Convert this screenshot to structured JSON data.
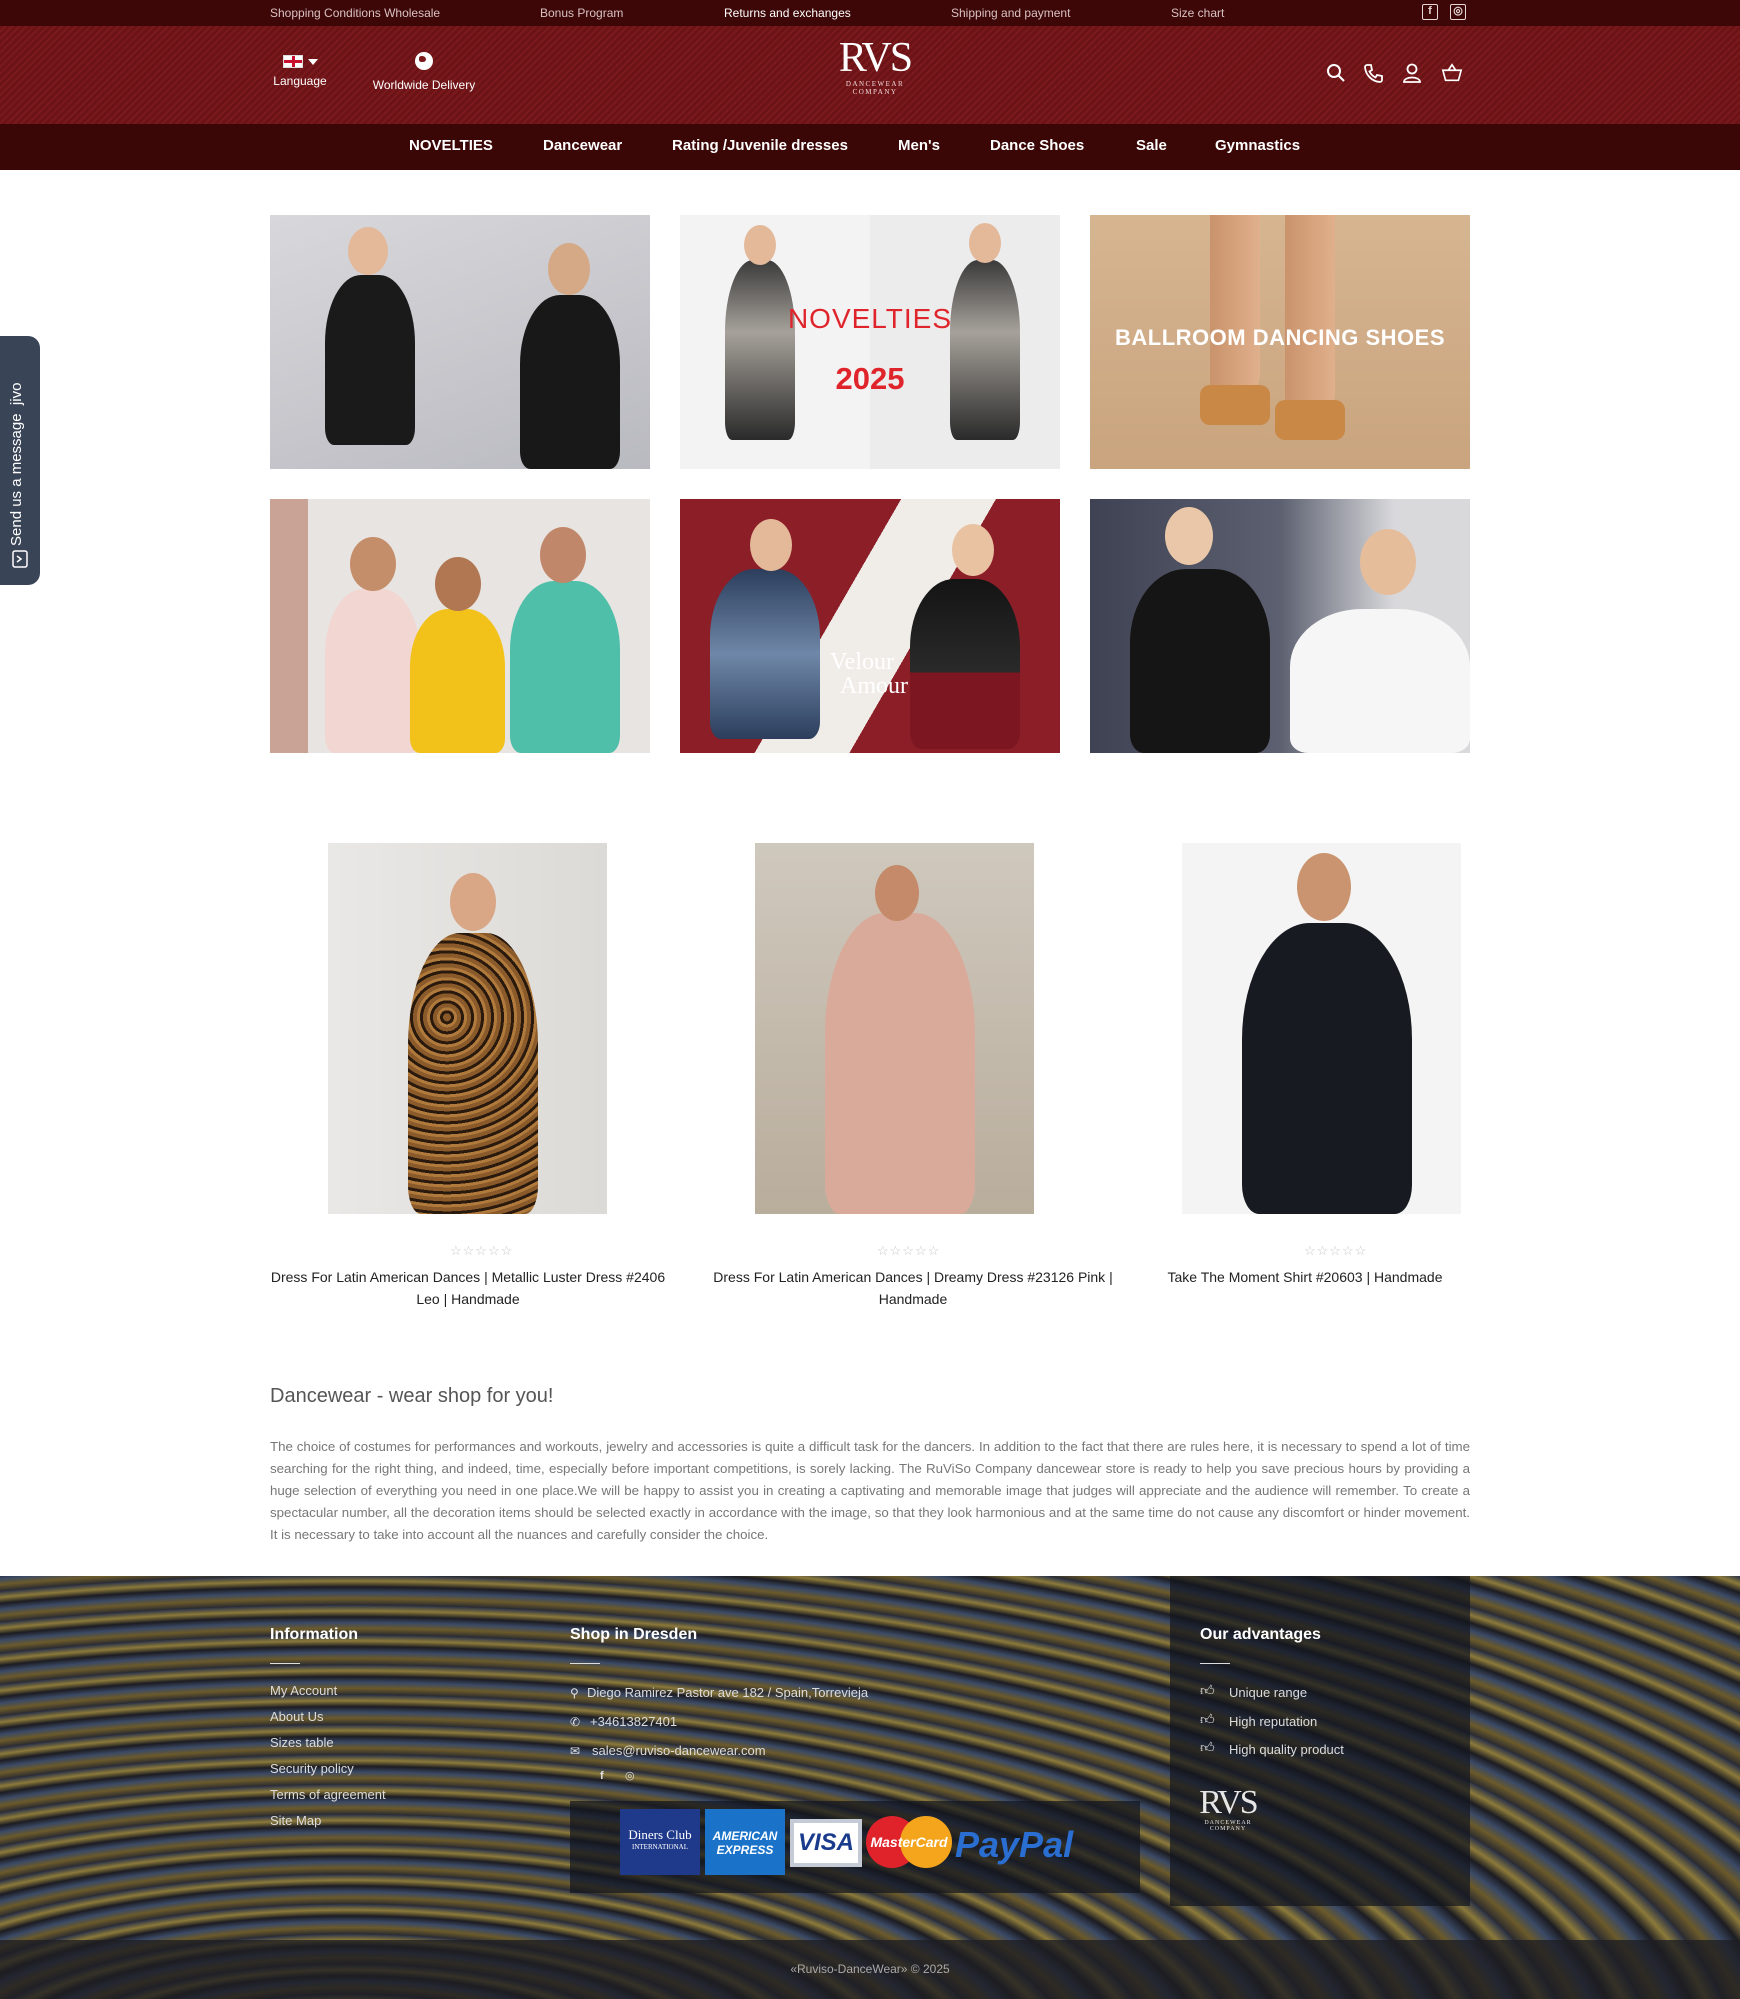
{
  "topbar": {
    "links": [
      "Shopping Conditions Wholesale",
      "Bonus Program",
      "Returns and exchanges",
      "Shipping and payment",
      "Size chart"
    ],
    "social": [
      "facebook-icon",
      "instagram-icon"
    ]
  },
  "header": {
    "language_label": "Language",
    "delivery_label": "Worldwide Delivery",
    "logo_text": "RVS",
    "logo_sub_1": "DANCEWEAR",
    "logo_sub_2": "COMPANY",
    "icons": [
      "search-icon",
      "phone-icon",
      "user-icon",
      "cart-icon"
    ]
  },
  "nav": {
    "items": [
      "NOVELTIES",
      "Dancewear",
      "Rating /Juvenile dresses",
      "Men's",
      "Dance Shoes",
      "Sale",
      "Gymnastics"
    ]
  },
  "tiles": {
    "novelties_word": "NOVELTIES",
    "novelties_year": "2025",
    "shoes_text": "BALLROOM DANCING SHOES",
    "velour_1": "Velour",
    "velour_2": "Amour"
  },
  "products": [
    {
      "title": "Dress For Latin American Dances | Metallic Luster Dress #2406 Leo | Handmade",
      "rating": "☆☆☆☆☆"
    },
    {
      "title": "Dress For Latin American Dances | Dreamy Dress #23126 Pink | Handmade",
      "rating": "☆☆☆☆☆"
    },
    {
      "title": "Take The Moment Shirt #20603 | Handmade",
      "rating": "☆☆☆☆☆"
    }
  ],
  "article": {
    "title": "Dancewear - wear shop for you!",
    "body": "The choice of costumes for performances and workouts, jewelry and accessories is quite a difficult task for the dancers. In addition to the fact that there are rules here, it is necessary to spend a lot of time searching for the right thing, and indeed, time, especially before important competitions, is sorely lacking. The RuViSo  Company dancewear store is ready to help you save precious hours by providing a huge selection of everything you need in one place.We will be happy to assist you in creating a captivating and memorable image that judges will appreciate and the audience will remember. To create a spectacular number, all the decoration items should be selected exactly in accordance with the image, so that they look harmonious and at the same time do not cause any discomfort or hinder movement. It is necessary to take into account all the nuances and carefully consider the choice."
  },
  "jivo": {
    "label": "Send us a message",
    "brand": "jivo"
  },
  "footer": {
    "info_title": "Information",
    "info_links": [
      "My Account",
      "About Us",
      "Sizes table",
      "Security policy",
      "Terms of agreement",
      "Site Map"
    ],
    "shop_title": "Shop in Dresden",
    "address": "Diego Ramirez Pastor ave 182 / Spain,Torrevieja",
    "phone": "+34613827401",
    "email": "sales@ruviso-dancewear.com",
    "adv_title": "Our advantages",
    "advantages": [
      "Unique range",
      "High reputation",
      "High quality product"
    ],
    "payments": {
      "diners_1": "Diners Club",
      "diners_2": "INTERNATIONAL",
      "amex_1": "AMERICAN",
      "amex_2": "EXPRESS",
      "visa": "VISA",
      "mastercard": "MasterCard",
      "paypal": "PayPal"
    },
    "copyright": "«Ruviso-DanceWear» © 2025"
  },
  "colors": {
    "topbar": "#3d0707",
    "header": "#6b1316",
    "nav": "#3a0606",
    "jivo": "#3a4457",
    "novelties_red": "#e0242b"
  }
}
